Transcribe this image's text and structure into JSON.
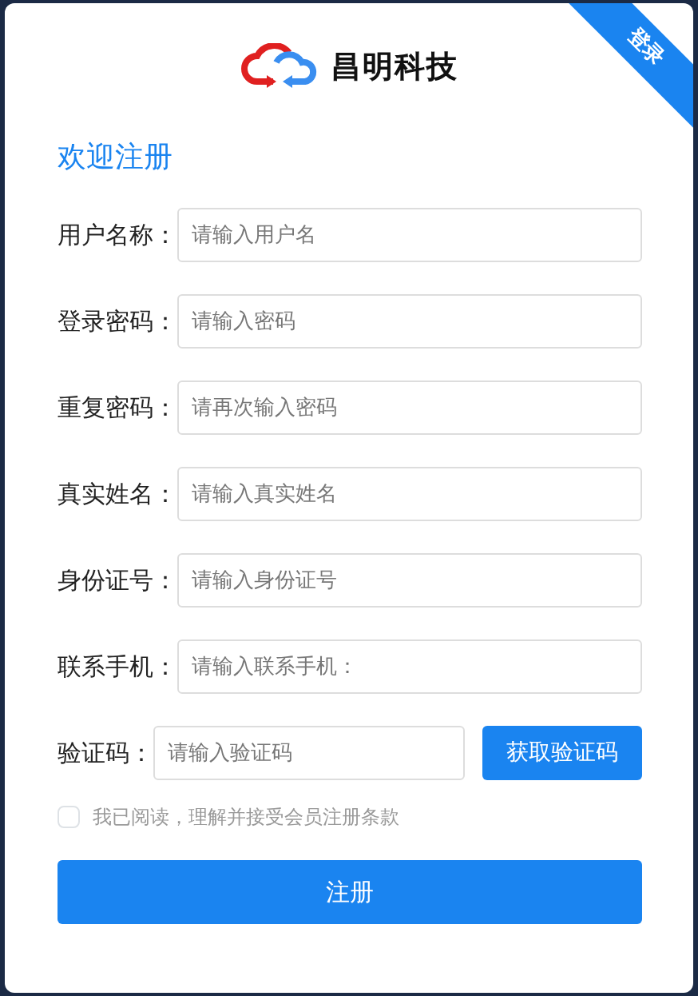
{
  "logo": {
    "name": "昌明科技"
  },
  "corner_tab": {
    "label": "登录"
  },
  "title": "欢迎注册",
  "fields": [
    {
      "kind": "text",
      "label": "用户名称：",
      "placeholder": "请输入用户名"
    },
    {
      "kind": "text",
      "label": "登录密码：",
      "placeholder": "请输入密码"
    },
    {
      "kind": "text",
      "label": "重复密码：",
      "placeholder": "请再次输入密码"
    },
    {
      "kind": "text",
      "label": "真实姓名：",
      "placeholder": "请输入真实姓名"
    },
    {
      "kind": "text",
      "label": "身份证号：",
      "placeholder": "请输入身份证号"
    },
    {
      "kind": "text",
      "label": "联系手机：",
      "placeholder": "请输入联系手机："
    },
    {
      "kind": "captcha",
      "label": "验证码：",
      "placeholder": "请输入验证码",
      "button": "获取验证码"
    }
  ],
  "agreement": {
    "text": "我已阅读，理解并接受会员注册条款",
    "checked": false
  },
  "submit": "注册"
}
